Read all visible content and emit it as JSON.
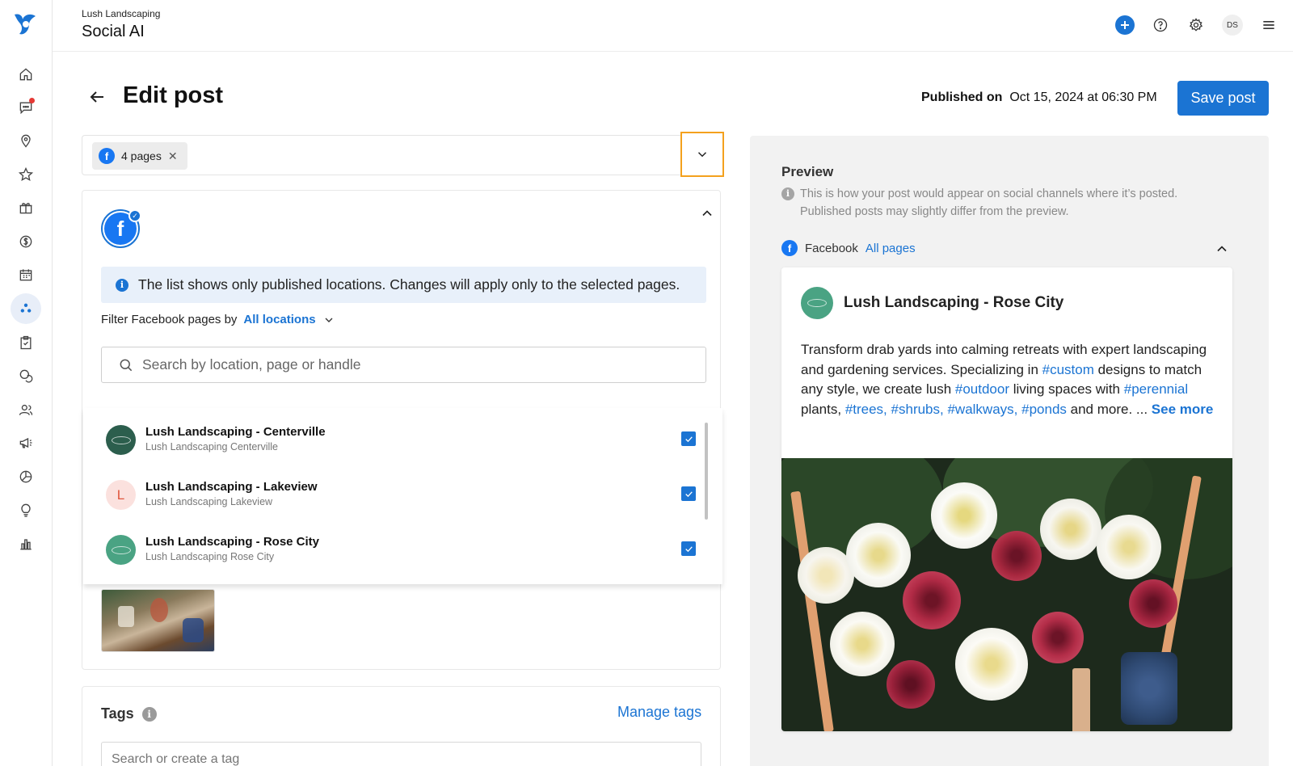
{
  "header": {
    "brand_sub": "Lush Landscaping",
    "brand_title": "Social AI",
    "avatar_initials": "DS",
    "icons": [
      "plus-icon",
      "help-icon",
      "gear-icon",
      "menu-icon"
    ]
  },
  "sidebar": {
    "items": [
      {
        "name": "home-icon"
      },
      {
        "name": "messages-icon",
        "has_notification": true
      },
      {
        "name": "location-icon"
      },
      {
        "name": "star-icon"
      },
      {
        "name": "gift-icon"
      },
      {
        "name": "dollar-icon"
      },
      {
        "name": "calendar-icon"
      },
      {
        "name": "social-icon",
        "active": true
      },
      {
        "name": "clipboard-icon"
      },
      {
        "name": "chat-bubbles-icon"
      },
      {
        "name": "people-icon"
      },
      {
        "name": "megaphone-icon"
      },
      {
        "name": "pie-chart-icon"
      },
      {
        "name": "lightbulb-icon"
      },
      {
        "name": "bar-chart-icon"
      }
    ]
  },
  "page": {
    "title": "Edit post",
    "published_label": "Published on",
    "published_value": "Oct 15, 2024 at 06:30 PM",
    "save_button": "Save post"
  },
  "pages_selector": {
    "chip_label": "4 pages"
  },
  "info_banner": "The list shows only published locations. Changes will apply only to the selected pages.",
  "filter": {
    "label": "Filter Facebook pages by",
    "value": "All locations"
  },
  "search": {
    "placeholder": "Search by location, page or handle"
  },
  "pages": [
    {
      "name": "Lush Landscaping - Centerville",
      "handle": "Lush Landscaping Centerville",
      "checked": true,
      "avatar": "logo-dark"
    },
    {
      "name": "Lush Landscaping - Lakeview",
      "handle": "Lush Landscaping Lakeview",
      "checked": true,
      "avatar": "L"
    },
    {
      "name": "Lush Landscaping - Rose City",
      "handle": "Lush Landscaping Rose City",
      "checked": true,
      "avatar": "logo-green"
    }
  ],
  "tags": {
    "title": "Tags",
    "manage_label": "Manage tags",
    "input_placeholder": "Search or create a tag"
  },
  "preview": {
    "title": "Preview",
    "note_line1": "This is how your post would appear on social channels where it’s posted.",
    "note_line2": "Published posts may slightly differ from the preview.",
    "channel": "Facebook",
    "channel_scope": "All pages",
    "post": {
      "author": "Lush Landscaping - Rose City",
      "text_parts": [
        {
          "t": "Transform drab yards into calming retreats with expert landscaping and gardening services. Specializing in "
        },
        {
          "t": "#custom",
          "tag": true
        },
        {
          "t": " designs to match any style, we create lush "
        },
        {
          "t": "#outdoor",
          "tag": true
        },
        {
          "t": " living spaces with "
        },
        {
          "t": "#perennial",
          "tag": true
        },
        {
          "t": " plants, "
        },
        {
          "t": "#trees,",
          "tag": true
        },
        {
          "t": " "
        },
        {
          "t": "#shrubs,",
          "tag": true
        },
        {
          "t": " "
        },
        {
          "t": "#walkways,",
          "tag": true
        },
        {
          "t": " "
        },
        {
          "t": "#ponds",
          "tag": true
        },
        {
          "t": " and more. ... "
        }
      ],
      "see_more": "See more"
    }
  },
  "colors": {
    "accent": "#1b74d3",
    "facebook": "#1877f2",
    "highlight_border": "#f4a11d",
    "notification": "#e53935"
  }
}
